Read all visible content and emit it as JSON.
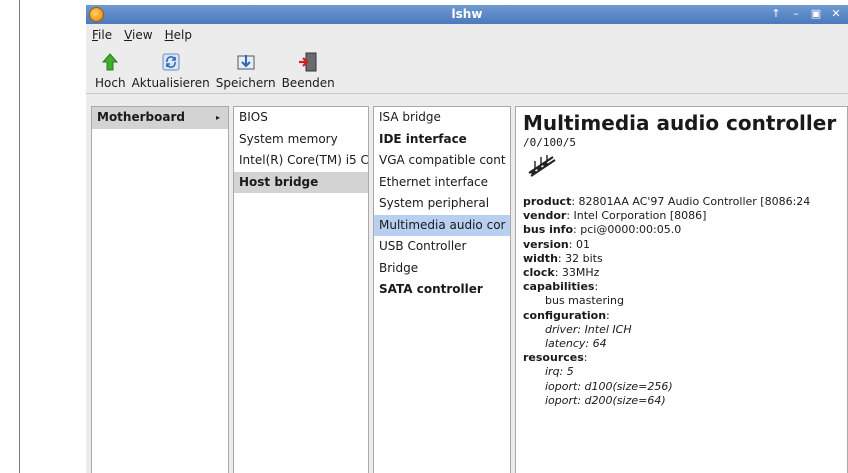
{
  "window": {
    "title": "lshw"
  },
  "menu": [
    {
      "label": "File",
      "mnemonic": "F",
      "rest": "ile"
    },
    {
      "label": "View",
      "mnemonic": "V",
      "rest": "iew"
    },
    {
      "label": "Help",
      "mnemonic": "H",
      "rest": "elp"
    }
  ],
  "toolbar": {
    "up": "Hoch",
    "refresh": "Aktualisieren",
    "save": "Speichern",
    "quit": "Beenden"
  },
  "columns": {
    "col1": [
      {
        "label": "Motherboard",
        "bold": true,
        "selected": true,
        "arrow": "▸"
      }
    ],
    "col2": [
      {
        "label": "BIOS"
      },
      {
        "label": "System memory"
      },
      {
        "label": "Intel(R) Core(TM) i5 C"
      },
      {
        "label": "Host bridge",
        "bold": true,
        "selected": true
      }
    ],
    "col3": [
      {
        "label": "ISA bridge"
      },
      {
        "label": "IDE interface",
        "bold": true
      },
      {
        "label": "VGA compatible cont"
      },
      {
        "label": "Ethernet interface"
      },
      {
        "label": "System peripheral"
      },
      {
        "label": "Multimedia audio cor",
        "highlighted": true
      },
      {
        "label": "USB Controller"
      },
      {
        "label": "Bridge"
      },
      {
        "label": "SATA controller",
        "bold": true
      }
    ]
  },
  "detail": {
    "title": "Multimedia audio controller",
    "path": "/0/100/5",
    "icon": "music-notes-icon",
    "product_key": "product",
    "product_val": ": 82801AA AC'97 Audio Controller [8086:24",
    "vendor_key": "vendor",
    "vendor_val": ": Intel Corporation [8086]",
    "businfo_key": "bus info",
    "businfo_val": ": pci@0000:00:05.0",
    "version_key": "version",
    "version_val": ": 01",
    "width_key": "width",
    "width_val": ": 32 bits",
    "clock_key": "clock",
    "clock_val": ": 33MHz",
    "capabilities_key": "capabilities",
    "capabilities_colon": ":",
    "cap1": "bus mastering",
    "configuration_key": "configuration",
    "configuration_colon": ":",
    "conf1": "driver: Intel ICH",
    "conf2": "latency: 64",
    "resources_key": "resources",
    "resources_colon": ":",
    "res1": "irq: 5",
    "res2": "ioport: d100(size=256)",
    "res3": "ioport: d200(size=64)"
  },
  "colors": {
    "titlebar": "#5a86c6",
    "highlight": "#b9cff0",
    "selected": "#d3d3d3"
  }
}
